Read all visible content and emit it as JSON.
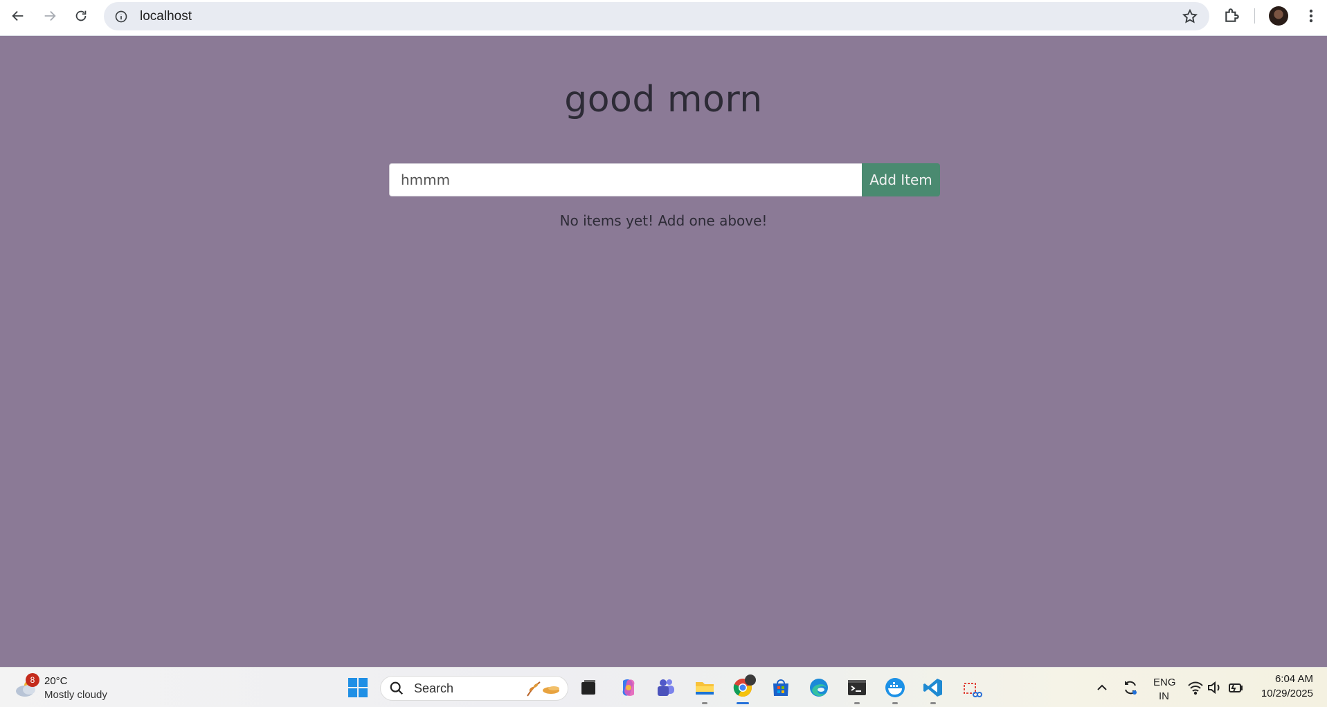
{
  "browser": {
    "url": "localhost",
    "icons": [
      "back-icon",
      "forward-icon",
      "reload-icon",
      "info-icon",
      "star-icon",
      "extensions-icon",
      "profile-avatar",
      "kebab-menu-icon"
    ]
  },
  "page": {
    "title": "good morn",
    "input": {
      "value": "hmmm",
      "placeholder": ""
    },
    "add_button_label": "Add Item",
    "empty_message": "No items yet! Add one above!",
    "colors": {
      "background": "#8b7a96",
      "button": "#4a8a70",
      "text": "#2d2b36"
    }
  },
  "taskbar": {
    "weather": {
      "badge": "8",
      "temperature": "20°C",
      "condition": "Mostly cloudy"
    },
    "search_label": "Search",
    "tray": {
      "language_top": "ENG",
      "language_bottom": "IN"
    },
    "clock": {
      "time": "6:04 AM",
      "date": "10/29/2025"
    }
  }
}
